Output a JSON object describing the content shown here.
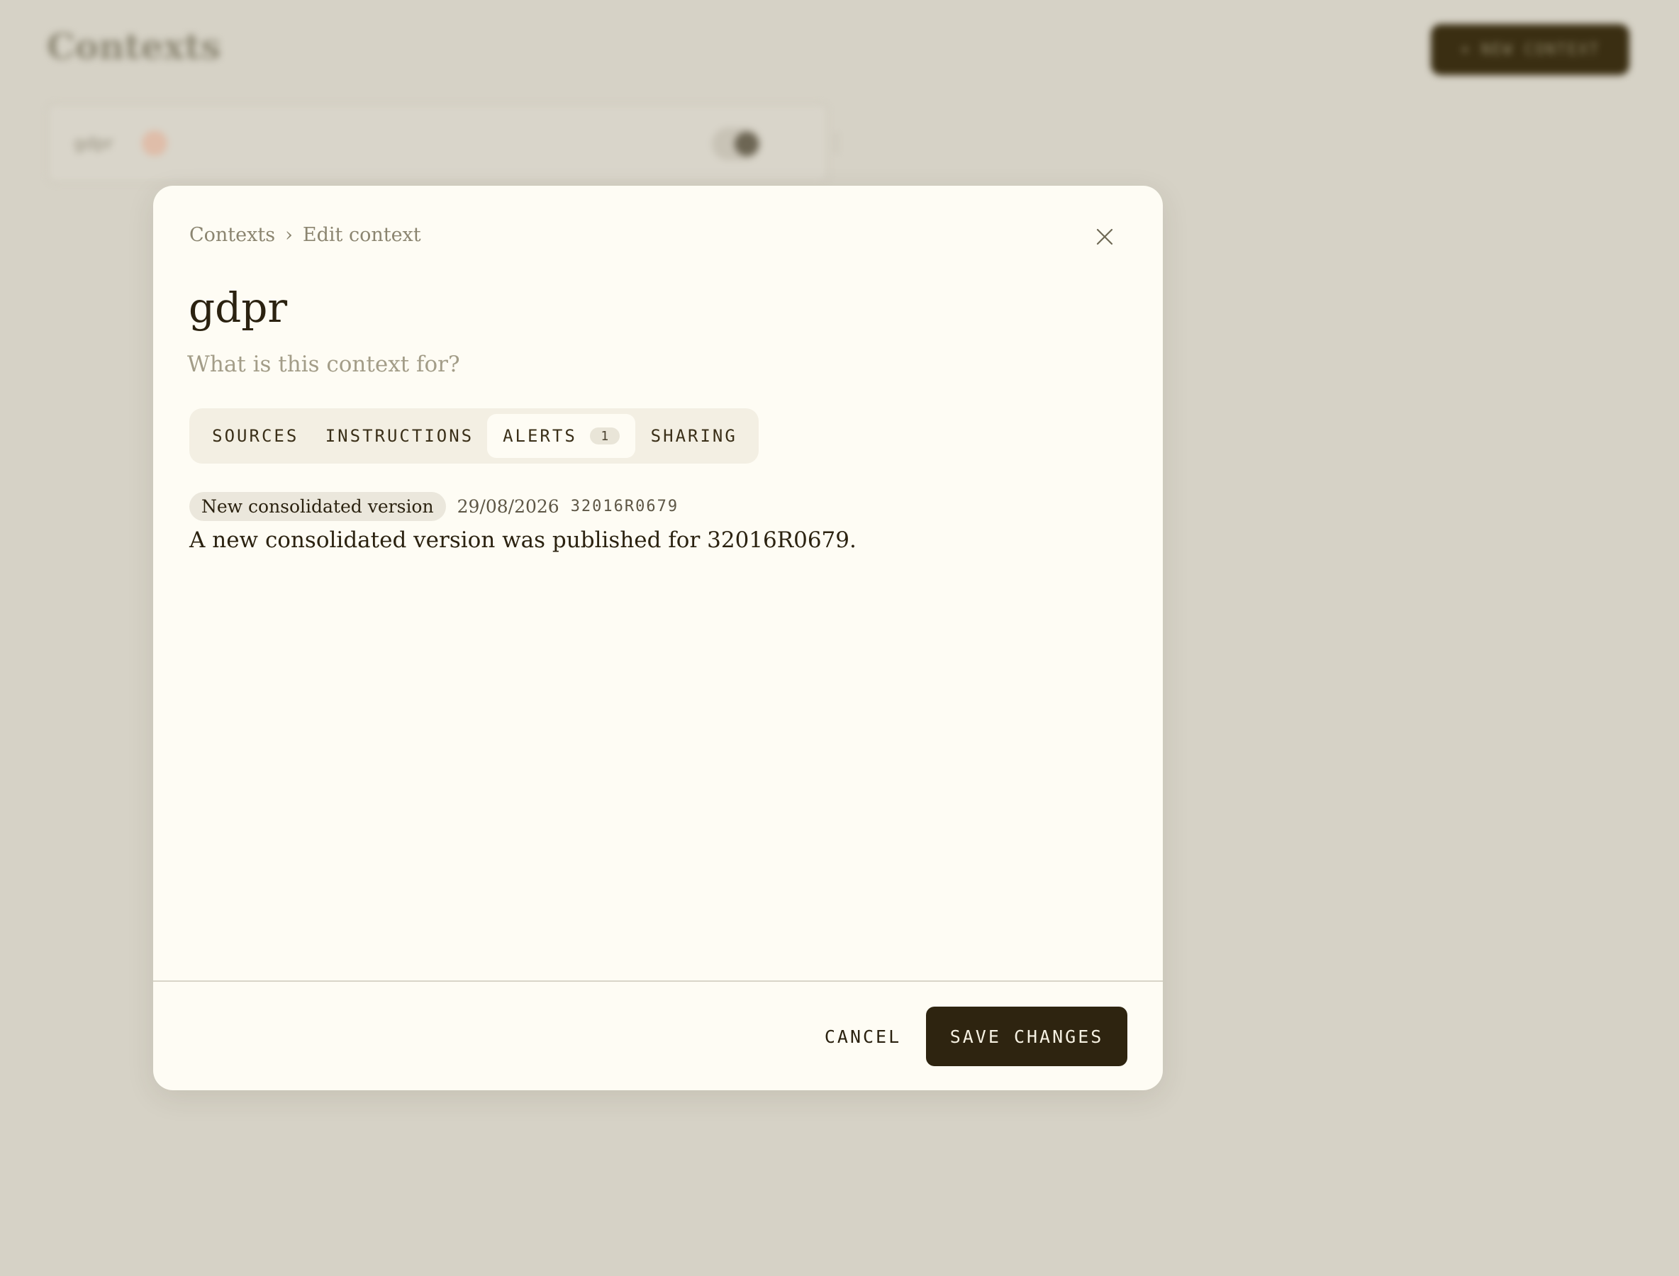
{
  "background": {
    "page_title": "Contexts",
    "new_context_button": {
      "icon": "plus-icon",
      "label": "NEW CONTEXT"
    },
    "context_card": {
      "name": "gdpr",
      "more_icon": "vertical-dots-icon"
    }
  },
  "modal": {
    "breadcrumb": {
      "root": "Contexts",
      "separator": "›",
      "current": "Edit context"
    },
    "close_icon": "close-icon",
    "title": "gdpr",
    "description": {
      "value": "",
      "placeholder": "What is this context for?"
    },
    "tabs": [
      {
        "label": "SOURCES"
      },
      {
        "label": "INSTRUCTIONS"
      },
      {
        "label": "ALERTS",
        "badge": "1",
        "active": true
      },
      {
        "label": "SHARING"
      }
    ],
    "alerts": [
      {
        "tag": "New consolidated version",
        "date": "29/08/2026",
        "code": "32016R0679",
        "message": "A new consolidated version was published for 32016R0679."
      }
    ],
    "footer": {
      "cancel_label": "CANCEL",
      "save_label": "SAVE CHANGES"
    }
  },
  "colors": {
    "backdrop": "#d6d2c6",
    "modal_background": "#fefcf4",
    "primary_button": "#2e2410",
    "text": "#2b2210",
    "muted_text": "#8b8570"
  }
}
